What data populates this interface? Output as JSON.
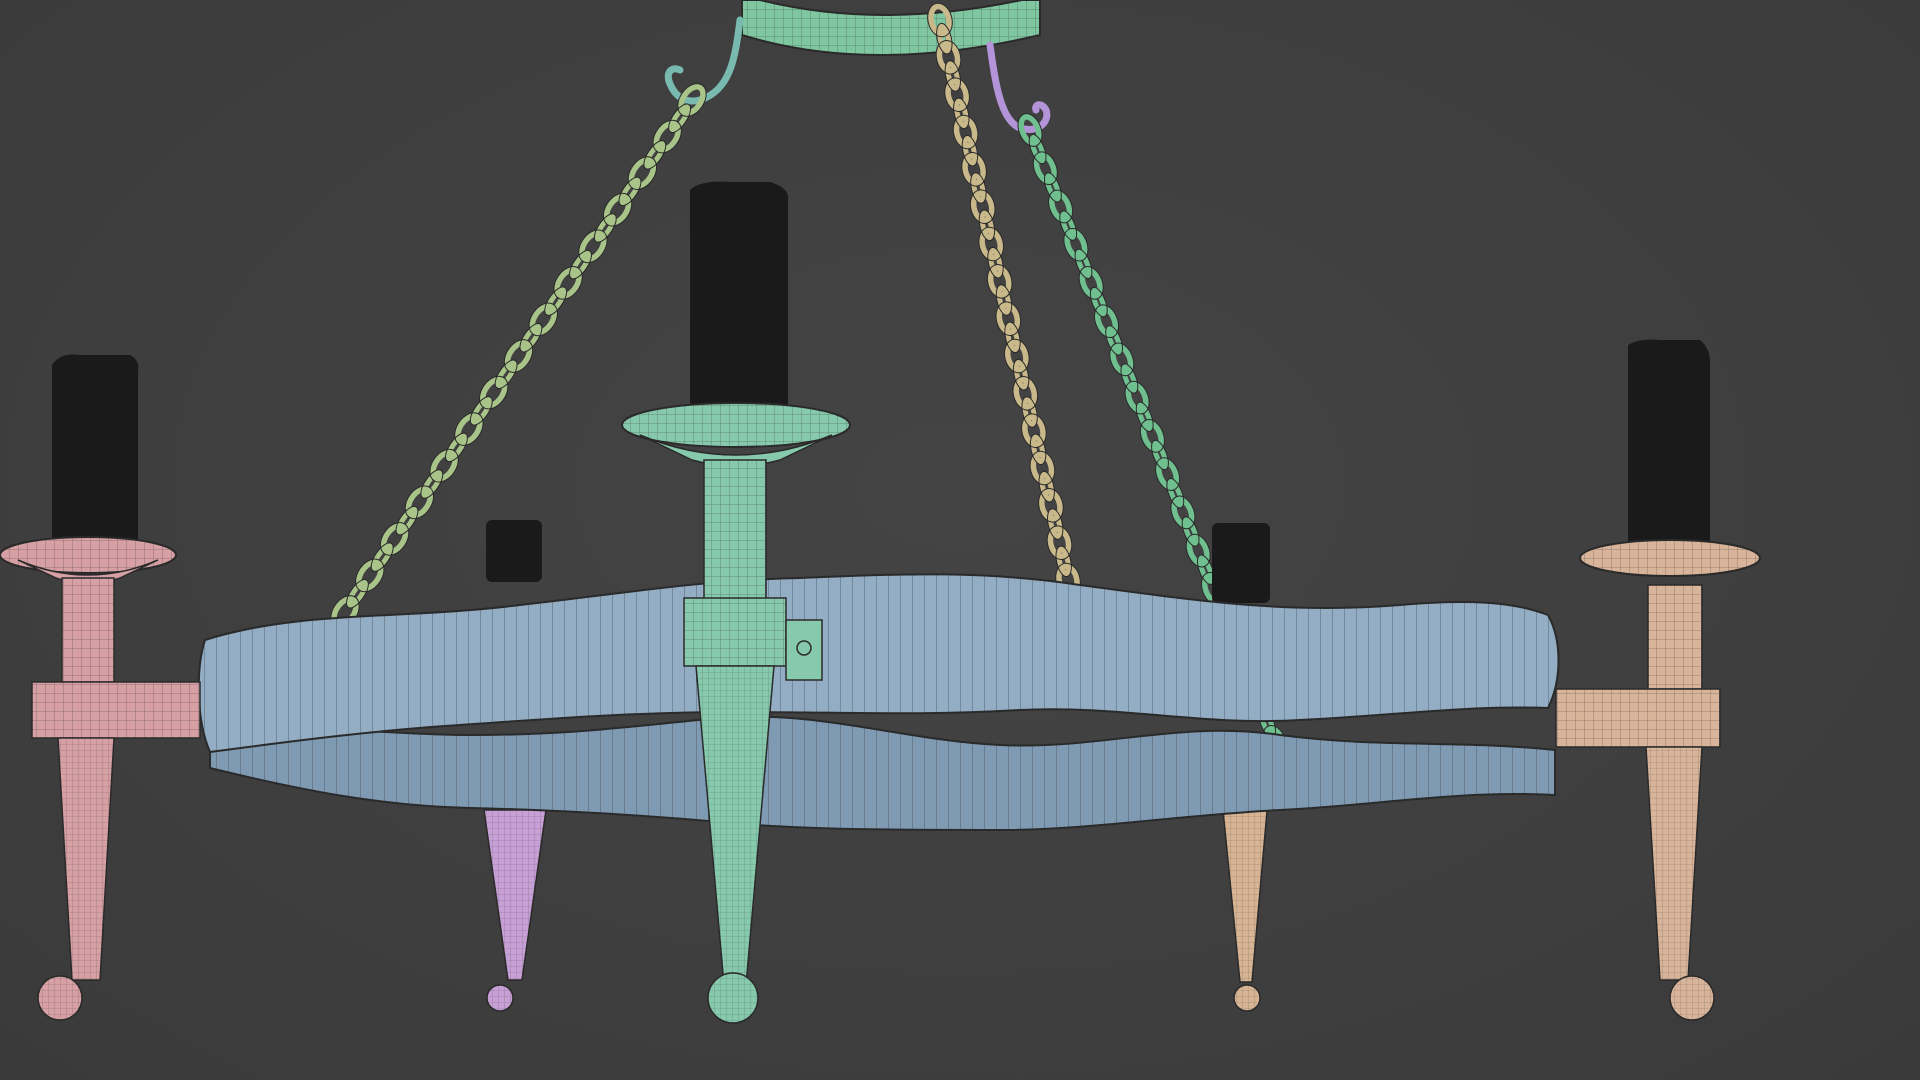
{
  "viewport": {
    "background": "#3f3f3f",
    "wire_color": "#2a2a2a"
  },
  "model": {
    "colors": {
      "crown": "#7fc7a0",
      "ring_band": "#93adc4",
      "ring_band_inner": "#7f9bb4",
      "chain_left": "#a9c488",
      "chain_middle": "#c9b98a",
      "chain_right": "#6fbf8f",
      "hook_left": "#78b9b0",
      "hook_right": "#b494d8",
      "candle": "#1a1a1a",
      "arm_left": "#d6a0a4",
      "arm_center": "#86c9ad",
      "arm_right": "#d8b49a",
      "arm_back_left": "#c7a0d6",
      "arm_back_right": "#d7b493"
    }
  }
}
